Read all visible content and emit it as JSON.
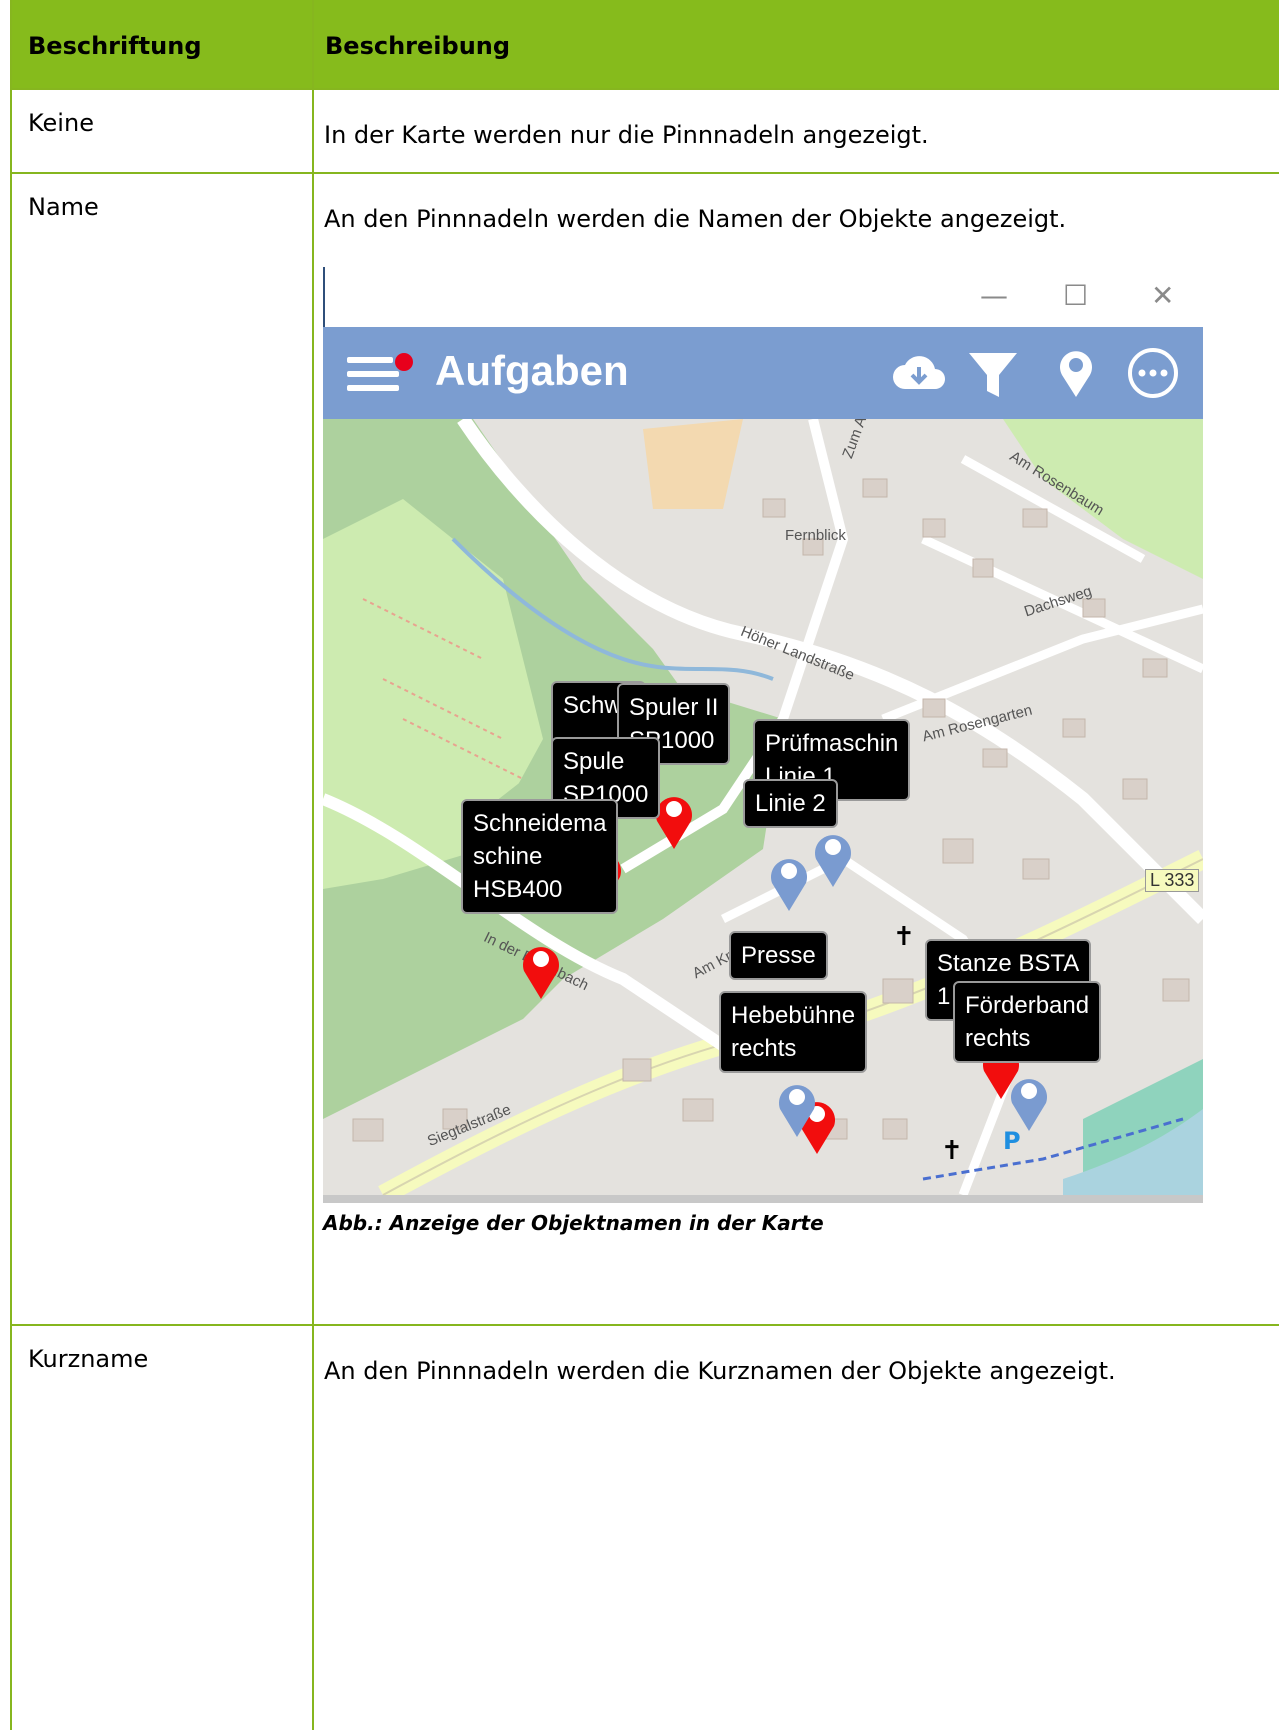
{
  "table": {
    "headers": {
      "col1": "Beschriftung",
      "col2": "Beschreibung"
    },
    "rows": [
      {
        "label": "Keine",
        "description": "In der Karte werden nur die Pinnnadeln angezeigt."
      },
      {
        "label": "Name",
        "description": "An den Pinnnadeln werden die Namen der Objekte angezeigt."
      },
      {
        "label": "Kurzname",
        "description": "An den Pinnnadeln werden die Kurznamen der Objekte angezeigt."
      }
    ]
  },
  "screenshot": {
    "window_buttons": {
      "minimize": "—",
      "maximize": "☐",
      "close": "✕"
    },
    "app_title": "Aufgaben",
    "icons": [
      "menu-icon",
      "cloud-download-icon",
      "filter-icon",
      "location-pin-icon",
      "more-icon"
    ],
    "colors": {
      "appbar": "#7b9dd0",
      "notification_dot": "#e8001c",
      "pin_red": "#f20d0d",
      "pin_blue": "#7a9bd0"
    },
    "map_streets": [
      "Fernblick",
      "Am Rosenbaum",
      "Dachsweg",
      "Höher Landstraße",
      "Am Rosengarten",
      "Am Knippen",
      "In der Baumbach",
      "Siegtalstraße",
      "L 333",
      "Zum A"
    ],
    "markers": [
      {
        "text": "Schw\nl",
        "pin": "red"
      },
      {
        "text": "Spuler II\nSP1000",
        "pin": "red"
      },
      {
        "text": "Spule\nSP1000",
        "pin": "blue"
      },
      {
        "text": "Prüfmaschin\nLinie 1",
        "pin": "blue"
      },
      {
        "text": "Linie 2",
        "pin": "blue"
      },
      {
        "text": "Schneidema\nschine\nHSB400",
        "pin": "red"
      },
      {
        "text": "Presse",
        "pin": "red"
      },
      {
        "text": "Hebebühne\nrechts",
        "pin": "red"
      },
      {
        "text": "Stanze BSTA\n1",
        "pin": "red"
      },
      {
        "text": "Förderband\nrechts",
        "pin": "blue"
      }
    ],
    "caption": "Abb.: Anzeige der Objektnamen in der Karte"
  }
}
